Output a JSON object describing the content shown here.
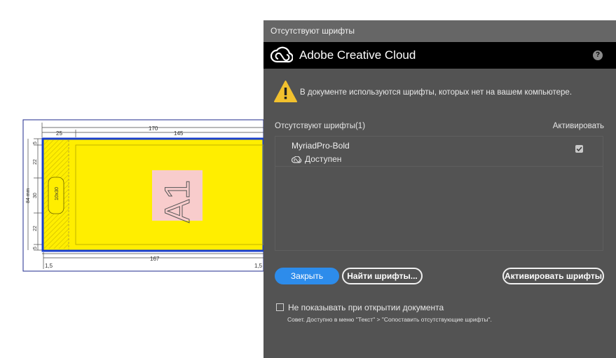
{
  "document": {
    "dimensions": {
      "total_width": "170",
      "left_part": "25",
      "right_part": "145",
      "bottom_width": "167",
      "left_offset": "1,5",
      "right_offset": "1,5",
      "height_label": "84 mm",
      "seg_top": "5",
      "seg_1": "22",
      "seg_2": "30",
      "seg_3": "22",
      "seg_bottom": "5"
    },
    "hole_label": "10x30",
    "panel_label": "A1",
    "colors": {
      "panel_fill": "#ffee00",
      "border_blue": "#1a3fcc",
      "label_bg": "#f8cccc"
    }
  },
  "dialog": {
    "window_title": "Отсутствуют шрифты",
    "header_title": "Adobe Creative Cloud",
    "help_label": "?",
    "warning_text": "В документе используются шрифты, которых нет на вашем компьютере.",
    "list_header_left": "Отсутствуют шрифты(1)",
    "list_header_right": "Активировать",
    "fonts": [
      {
        "name": "MyriadPro-Bold",
        "status": "Доступен",
        "checked": true
      }
    ],
    "buttons": {
      "close": "Закрыть",
      "find": "Найти шрифты...",
      "activate": "Активировать шрифты"
    },
    "dont_show_label": "Не показывать при открытии документа",
    "dont_show_checked": false,
    "tip": "Совет. Доступно в меню \"Текст\" > \"Сопоставить отсутствующие шрифты\".",
    "colors": {
      "accent": "#2d8ceb",
      "warning": "#f2c12e",
      "panel": "#535353"
    }
  }
}
